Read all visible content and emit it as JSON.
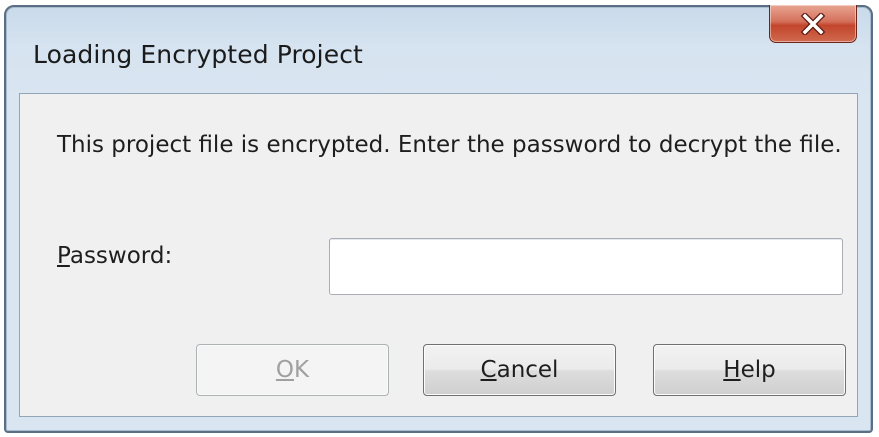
{
  "window": {
    "title": "Loading Encrypted Project",
    "close_icon": "close-x-icon"
  },
  "dialog": {
    "message": "This project file is encrypted. Enter the password to decrypt the file.",
    "password_label_mnemonic": "P",
    "password_label_rest": "assword:",
    "password_value": ""
  },
  "buttons": {
    "ok_mnemonic": "O",
    "ok_rest": "K",
    "ok_enabled": false,
    "cancel_mnemonic": "C",
    "cancel_rest": "ancel",
    "help_mnemonic": "H",
    "help_rest": "elp"
  },
  "colors": {
    "titlebar": "#d6e3f0",
    "close_button": "#c2452b",
    "client_background": "#f0f0f0",
    "disabled_text": "#a0a0a0"
  }
}
